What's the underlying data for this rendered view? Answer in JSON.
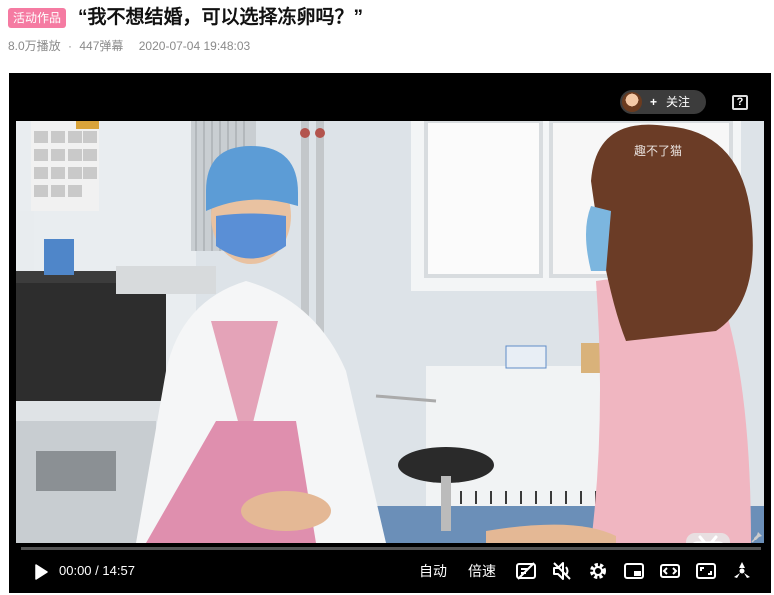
{
  "header": {
    "badge": "活动作品",
    "title": "“我不想结婚，可以选择冻卵吗？”",
    "plays": "8.0万播放",
    "separator": "·",
    "danmaku": "447弹幕",
    "date": "2020-07-04 19:48:03"
  },
  "player": {
    "follow_plus": "+",
    "follow_label": "关注",
    "help_label": "?",
    "watermark": "趣不了猫"
  },
  "controls": {
    "current_time": "00:00",
    "separator": "/",
    "duration": "14:57",
    "quality_label": "自动",
    "speed_label": "倍速",
    "progress": 0
  },
  "icons": [
    "play-icon",
    "danmaku-off-icon",
    "volume-mute-icon",
    "settings-gear-icon",
    "picture-in-picture-icon",
    "widescreen-icon",
    "web-fullscreen-icon",
    "fullscreen-icon",
    "pin-icon",
    "bilibili-tv-icon"
  ],
  "colors": {
    "badge": "#f57ba2",
    "player_bg": "#000000",
    "scrub": "#777777"
  }
}
